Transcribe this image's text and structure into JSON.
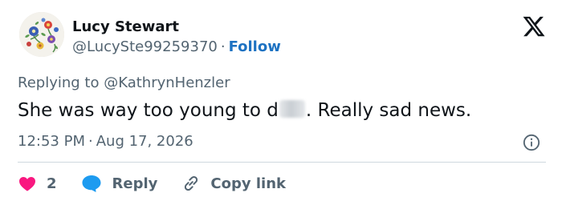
{
  "author": {
    "name": "Lucy Stewart",
    "handle": "@LucySte99259370",
    "separator": "·",
    "follow_label": "Follow"
  },
  "reply_context": {
    "prefix": "Replying to",
    "mention": "@KathrynHenzler"
  },
  "tweet": {
    "text_before": "She was way too young to d",
    "text_after": ". Really sad news.",
    "time": "12:53 PM",
    "separator": "·",
    "date": "Aug 17, 2026"
  },
  "actions": {
    "like_count": "2",
    "reply_label": "Reply",
    "copy_label": "Copy link"
  },
  "icons": {
    "logo": "x-logo-icon",
    "info": "info-icon",
    "like": "heart-icon",
    "reply": "speech-bubble-icon",
    "copy": "link-icon"
  },
  "colors": {
    "name": "#0f1419",
    "secondary": "#536471",
    "follow": "#1d72c2",
    "like": "#f91880",
    "reply": "#1d9bf0",
    "divider": "#cfd9de"
  }
}
